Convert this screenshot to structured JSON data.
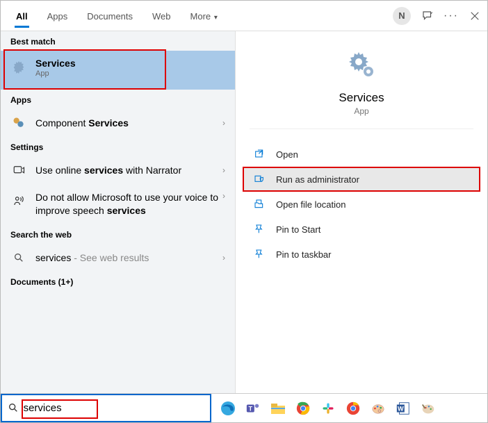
{
  "header": {
    "tabs": [
      "All",
      "Apps",
      "Documents",
      "Web",
      "More"
    ],
    "avatar_letter": "N"
  },
  "left": {
    "best_match_label": "Best match",
    "best_match": {
      "title": "Services",
      "subtitle": "App"
    },
    "apps_label": "Apps",
    "apps_item": {
      "prefix": "Component ",
      "bold": "Services"
    },
    "settings_label": "Settings",
    "settings1": {
      "prefix": "Use online ",
      "bold": "services",
      "suffix": " with Narrator"
    },
    "settings2": {
      "prefix": "Do not allow Microsoft to use your voice to improve speech ",
      "bold": "services"
    },
    "web_label": "Search the web",
    "web_item": {
      "term": "services",
      "suffix": " - See web results"
    },
    "docs_label": "Documents (1+)"
  },
  "right": {
    "title": "Services",
    "subtitle": "App",
    "actions": [
      "Open",
      "Run as administrator",
      "Open file location",
      "Pin to Start",
      "Pin to taskbar"
    ]
  },
  "search": {
    "value": "services"
  }
}
